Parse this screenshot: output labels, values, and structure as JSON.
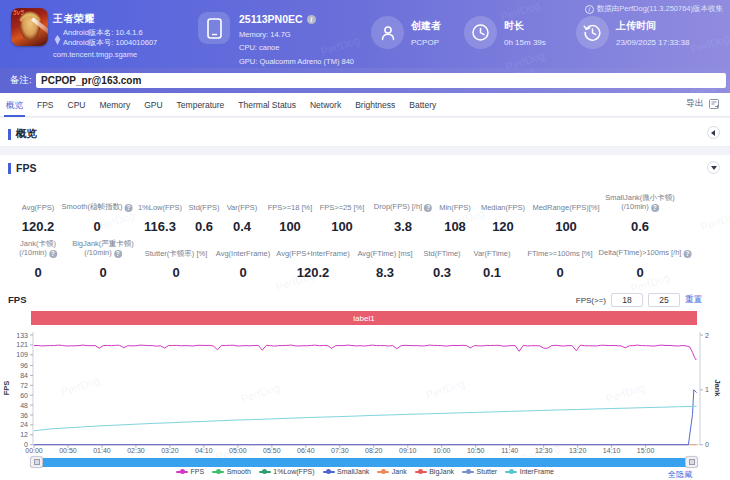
{
  "watermark_text": "PerfDog",
  "header": {
    "app": {
      "title": "王者荣耀",
      "icon_name": "game-app-icon",
      "icon_badge": "5v5",
      "version_name": "Android版本名: 10.4.1.6",
      "version_code": "Android版本号: 1004010607",
      "package": "com.tencent.tmgp.sgame"
    },
    "device": {
      "model": "25113PN0EC",
      "memory": "Memory: 14.7G",
      "cpu": "CPU: canoe",
      "gpu": "GPU: Qualcomm Adreno (TM) 840"
    },
    "creator": {
      "label": "创建者",
      "value": "PCPOP"
    },
    "duration": {
      "label": "时长",
      "value": "0h 15m 39s"
    },
    "upload": {
      "label": "上传时间",
      "value": "23/09/2025 17:33:38"
    },
    "collect_note": "数据由PerfDog(11.3.250764)版本收集"
  },
  "remark": {
    "label": "备注:",
    "value": "PCPOP_pr@163.com"
  },
  "tabs": {
    "items": [
      "概览",
      "FPS",
      "CPU",
      "Memory",
      "GPU",
      "Temperature",
      "Thermal Status",
      "Network",
      "Brightness",
      "Battery"
    ],
    "active_index": 0,
    "export_label": "导出"
  },
  "sections": {
    "overview_title": "概览",
    "fps_title": "FPS"
  },
  "stats": {
    "row1": [
      {
        "label": "Avg(FPS)",
        "value": "120.2"
      },
      {
        "label": "Smooth(稳帧指数)",
        "help": true,
        "value": "0"
      },
      {
        "label": "1%Low(FPS)",
        "value": "116.3"
      },
      {
        "label": "Std(FPS)",
        "value": "0.6"
      },
      {
        "label": "Var(FPS)",
        "value": "0.4"
      },
      {
        "label": "FPS>=18 [%]",
        "value": "100"
      },
      {
        "label": "FPS>=25 [%]",
        "value": "100"
      },
      {
        "label": "Drop(FPS) [/h]",
        "help": true,
        "value": "3.8"
      },
      {
        "label": "Min(FPS)",
        "value": "108"
      },
      {
        "label": "Median(FPS)",
        "value": "120"
      },
      {
        "label": "MedRange(FPS)[%]",
        "value": "100"
      },
      {
        "label": "SmallJank(微小卡顿)",
        "label2": "(/10min)",
        "help": true,
        "value": "0.6"
      }
    ],
    "row2": [
      {
        "label": "Jank(卡顿)",
        "label2": "(/10min)",
        "help": true,
        "value": "0"
      },
      {
        "label": "BigJank(严重卡顿)",
        "label2": "(/10min)",
        "help": true,
        "value": "0"
      },
      {
        "label": "Stutter(卡顿率) [%]",
        "value": "0"
      },
      {
        "label": "Avg(InterFrame)",
        "value": "0"
      },
      {
        "label": "Avg(FPS+InterFrame)",
        "value": "120.2"
      },
      {
        "label": "Avg(FTime) [ms]",
        "value": "8.3"
      },
      {
        "label": "Std(FTime)",
        "value": "0.3"
      },
      {
        "label": "Var(FTime)",
        "value": "0.1"
      },
      {
        "label": "FTime>=100ms [%]",
        "value": "0"
      },
      {
        "label": "Delta(FTime)>100ms [/h]",
        "help": true,
        "value": "0"
      }
    ]
  },
  "chart": {
    "title": "FPS",
    "threshold_label": "FPS(>=)",
    "threshold1": "18",
    "threshold2": "25",
    "reset_label": "重置",
    "band_label": "label1",
    "y_axis_label": "FPS",
    "y2_axis_label": "Jank",
    "hide_all_label": "全隐藏",
    "legend": [
      {
        "name": "FPS",
        "color": "#d437c3"
      },
      {
        "name": "Smooth",
        "color": "#3fbf6e"
      },
      {
        "name": "1%Low(FPS)",
        "color": "#2f9e6b"
      },
      {
        "name": "SmallJank",
        "color": "#4f63d2"
      },
      {
        "name": "Jank",
        "color": "#ef8a54"
      },
      {
        "name": "BigJank",
        "color": "#e45b58"
      },
      {
        "name": "Stutter",
        "color": "#7791c8"
      },
      {
        "name": "InterFrame",
        "color": "#56c5d0"
      }
    ]
  },
  "chart_data": {
    "type": "line",
    "title": "FPS",
    "band_annotation": "label1",
    "x_ticks": [
      "00:00",
      "00:50",
      "01:40",
      "02:30",
      "03:20",
      "04:10",
      "05:00",
      "05:50",
      "06:40",
      "07:30",
      "08:20",
      "09:10",
      "10:00",
      "10:50",
      "11:40",
      "12:30",
      "13:20",
      "14:10",
      "15:00"
    ],
    "x_tick_seconds": 50,
    "x_range_seconds": [
      0,
      980
    ],
    "y_left": {
      "label": "FPS",
      "ticks": [
        0,
        12,
        24,
        36,
        48,
        60,
        72,
        84,
        96,
        109,
        121,
        133
      ],
      "range": [
        0,
        133
      ]
    },
    "y_right": {
      "label": "Jank",
      "ticks": [
        0,
        1,
        2
      ],
      "range": [
        0,
        2
      ]
    },
    "series": [
      {
        "name": "FPS",
        "color": "#d437c3",
        "axis": "left",
        "points": [
          [
            0,
            120.2
          ],
          [
            6,
            120.3
          ],
          [
            12,
            119.7
          ],
          [
            18,
            120.0
          ],
          [
            24,
            120.2
          ],
          [
            30,
            120.2
          ],
          [
            36,
            120.7
          ],
          [
            42,
            120.3
          ],
          [
            48,
            119.7
          ],
          [
            54,
            119.9
          ],
          [
            60,
            119.9
          ],
          [
            66,
            120.2
          ],
          [
            72,
            120.8
          ],
          [
            78,
            120.2
          ],
          [
            84,
            120.0
          ],
          [
            90,
            120.1
          ],
          [
            96,
            117.0
          ],
          [
            102,
            120.1
          ],
          [
            108,
            120.4
          ],
          [
            114,
            120.0
          ],
          [
            120,
            120.5
          ],
          [
            126,
            120.5
          ],
          [
            132,
            117.6
          ],
          [
            138,
            120.0
          ],
          [
            144,
            119.8
          ],
          [
            150,
            119.9
          ],
          [
            156,
            120.7
          ],
          [
            162,
            120.5
          ],
          [
            168,
            120.1
          ],
          [
            174,
            120.1
          ],
          [
            180,
            119.6
          ],
          [
            186,
            119.9
          ],
          [
            192,
            117.2
          ],
          [
            198,
            120.2
          ],
          [
            204,
            120.3
          ],
          [
            210,
            120.4
          ],
          [
            216,
            119.9
          ],
          [
            222,
            120.1
          ],
          [
            228,
            120.0
          ],
          [
            234,
            119.7
          ],
          [
            240,
            120.4
          ],
          [
            246,
            120.5
          ],
          [
            252,
            120.3
          ],
          [
            258,
            120.4
          ],
          [
            264,
            119.7
          ],
          [
            270,
            115.0
          ],
          [
            276,
            120.4
          ],
          [
            282,
            120.3
          ],
          [
            288,
            120.5
          ],
          [
            294,
            120.5
          ],
          [
            300,
            119.7
          ],
          [
            306,
            119.9
          ],
          [
            312,
            120.2
          ],
          [
            318,
            119.9
          ],
          [
            324,
            120.3
          ],
          [
            330,
            120.4
          ],
          [
            336,
            114.6
          ],
          [
            342,
            120.5
          ],
          [
            348,
            120.0
          ],
          [
            354,
            119.6
          ],
          [
            360,
            120.1
          ],
          [
            366,
            120.2
          ],
          [
            372,
            120.4
          ],
          [
            378,
            120.7
          ],
          [
            384,
            119.9
          ],
          [
            390,
            119.7
          ],
          [
            396,
            120.0
          ],
          [
            402,
            119.9
          ],
          [
            408,
            120.4
          ],
          [
            414,
            120.6
          ],
          [
            420,
            120.0
          ],
          [
            426,
            120.3
          ],
          [
            432,
            120.2
          ],
          [
            438,
            116.8
          ],
          [
            444,
            120.1
          ],
          [
            450,
            120.1
          ],
          [
            456,
            120.2
          ],
          [
            462,
            120.8
          ],
          [
            468,
            120.3
          ],
          [
            474,
            119.8
          ],
          [
            480,
            120.0
          ],
          [
            486,
            119.7
          ],
          [
            492,
            120.2
          ],
          [
            498,
            120.8
          ],
          [
            504,
            120.2
          ],
          [
            510,
            120.2
          ],
          [
            516,
            120.1
          ],
          [
            522,
            119.7
          ],
          [
            528,
            120.2
          ],
          [
            534,
            116.4
          ],
          [
            540,
            120.0
          ],
          [
            546,
            120.5
          ],
          [
            552,
            120.3
          ],
          [
            558,
            120.0
          ],
          [
            564,
            120.1
          ],
          [
            570,
            119.7
          ],
          [
            576,
            119.9
          ],
          [
            582,
            120.7
          ],
          [
            588,
            120.4
          ],
          [
            594,
            120.3
          ],
          [
            600,
            120.2
          ],
          [
            606,
            119.5
          ],
          [
            612,
            120.0
          ],
          [
            618,
            120.4
          ],
          [
            624,
            120.2
          ],
          [
            630,
            120.5
          ],
          [
            636,
            120.3
          ],
          [
            642,
            117.4
          ],
          [
            648,
            120.2
          ],
          [
            654,
            119.9
          ],
          [
            660,
            119.8
          ],
          [
            666,
            120.4
          ],
          [
            672,
            120.3
          ],
          [
            678,
            120.4
          ],
          [
            684,
            120.5
          ],
          [
            690,
            119.6
          ],
          [
            696,
            119.7
          ],
          [
            702,
            120.2
          ],
          [
            708,
            120.2
          ],
          [
            714,
            113.2
          ],
          [
            720,
            120.5
          ],
          [
            726,
            119.7
          ],
          [
            732,
            120.0
          ],
          [
            738,
            120.0
          ],
          [
            744,
            119.9
          ],
          [
            750,
            117.0
          ],
          [
            756,
            117.0
          ],
          [
            762,
            120.2
          ],
          [
            768,
            120.5
          ],
          [
            774,
            119.9
          ],
          [
            780,
            119.7
          ],
          [
            786,
            120.1
          ],
          [
            792,
            120.0
          ],
          [
            798,
            114.0
          ],
          [
            804,
            120.8
          ],
          [
            810,
            120.0
          ],
          [
            816,
            119.9
          ],
          [
            822,
            119.9
          ],
          [
            828,
            119.8
          ],
          [
            834,
            120.5
          ],
          [
            840,
            120.5
          ],
          [
            846,
            120.1
          ],
          [
            852,
            120.3
          ],
          [
            858,
            120.0
          ],
          [
            864,
            119.8
          ],
          [
            870,
            117.4
          ],
          [
            876,
            119.9
          ],
          [
            882,
            120.2
          ],
          [
            888,
            120.7
          ],
          [
            894,
            120.2
          ],
          [
            900,
            120.0
          ],
          [
            906,
            119.9
          ],
          [
            912,
            119.6
          ],
          [
            918,
            120.3
          ],
          [
            924,
            120.7
          ],
          [
            930,
            120.3
          ],
          [
            936,
            120.3
          ],
          [
            942,
            119.9
          ],
          [
            948,
            119.7
          ],
          [
            954,
            120.3
          ],
          [
            960,
            119.8
          ],
          [
            965,
            118.5
          ],
          [
            969,
            112.0
          ],
          [
            972,
            106.0
          ],
          [
            974,
            103.2
          ],
          [
            975,
            104.0
          ]
        ]
      },
      {
        "name": "InterFrame",
        "color": "#7fd4dc",
        "axis": "left",
        "points": [
          [
            0,
            16.8
          ],
          [
            25,
            19.1
          ],
          [
            50,
            20.5
          ],
          [
            75,
            21.7
          ],
          [
            100,
            22.9
          ],
          [
            125,
            23.9
          ],
          [
            150,
            24.8
          ],
          [
            175,
            25.8
          ],
          [
            200,
            26.6
          ],
          [
            225,
            27.5
          ],
          [
            250,
            28.3
          ],
          [
            275,
            29.1
          ],
          [
            300,
            29.9
          ],
          [
            325,
            30.6
          ],
          [
            350,
            31.3
          ],
          [
            375,
            32.1
          ],
          [
            400,
            32.8
          ],
          [
            425,
            33.5
          ],
          [
            450,
            34.1
          ],
          [
            475,
            34.8
          ],
          [
            500,
            35.5
          ],
          [
            525,
            36.1
          ],
          [
            550,
            36.8
          ],
          [
            575,
            37.4
          ],
          [
            600,
            38.0
          ],
          [
            625,
            38.6
          ],
          [
            650,
            39.2
          ],
          [
            675,
            39.8
          ],
          [
            700,
            40.4
          ],
          [
            725,
            41.0
          ],
          [
            750,
            41.6
          ],
          [
            775,
            42.2
          ],
          [
            800,
            42.7
          ],
          [
            825,
            43.3
          ],
          [
            850,
            43.9
          ],
          [
            875,
            44.4
          ],
          [
            900,
            45.0
          ],
          [
            925,
            45.5
          ],
          [
            950,
            46.1
          ],
          [
            975,
            46.6
          ]
        ]
      },
      {
        "name": "SmallJank",
        "color": "#5668d8",
        "axis": "right",
        "points": [
          [
            0,
            0
          ],
          [
            963,
            0
          ],
          [
            969,
            0.55
          ],
          [
            971,
            1
          ],
          [
            975,
            0.95
          ]
        ]
      },
      {
        "name": "Jank",
        "color": "#e2a77e",
        "axis": "right",
        "points": [
          [
            0,
            0
          ],
          [
            975,
            0
          ]
        ]
      }
    ]
  }
}
